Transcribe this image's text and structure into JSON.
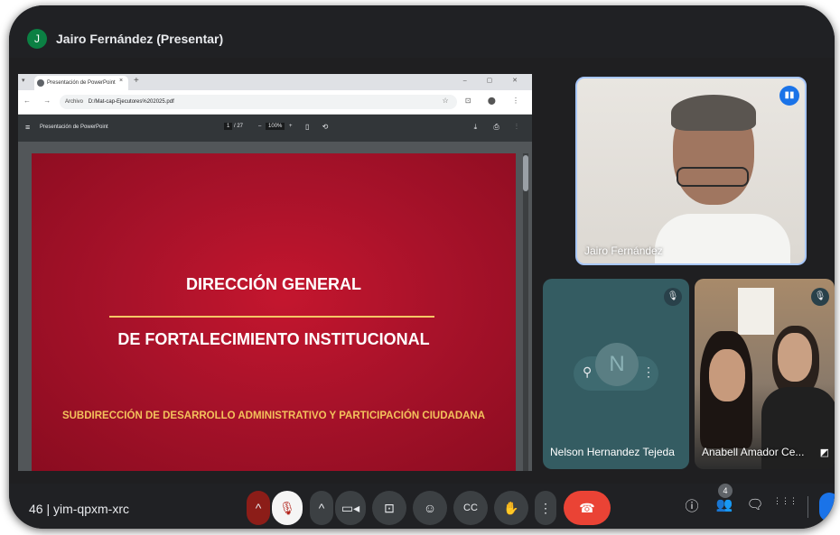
{
  "presenter": {
    "avatar_initial": "J",
    "title": "Jairo Fernández (Presentar)"
  },
  "browser": {
    "tab_title": "Presentación de PowerPoint",
    "tab_close": "×",
    "new_tab": "+",
    "nav_glyphs": "← → C",
    "address_chip": "Archivo",
    "address": "D:/Mat-cap-Ejecutores%202025.pdf",
    "window_controls": "– ▢ ✕",
    "addr_icons": "☆ ⊡ ⬤ ⋮"
  },
  "pdf_viewer": {
    "menu_glyph": "≡",
    "title": "Presentación de PowerPoint",
    "page_current": "1",
    "page_total": "/ 27",
    "zoom_minus": "–",
    "zoom_value": "100%",
    "zoom_plus": "+",
    "tool_glyphs": "▯ ⟲",
    "right_glyphs": "⤓ ⎙ ⋮"
  },
  "slide": {
    "heading_1": "DIRECCIÓN GENERAL",
    "heading_2": "DE FORTALECIMIENTO INSTITUCIONAL",
    "subheading": "SUBDIRECCIÓN DE DESARROLLO ADMINISTRATIVO Y PARTICIPACIÓN CIUDADANA"
  },
  "participants": [
    {
      "name": "Jairo Fernández",
      "state": "speaking"
    },
    {
      "name": "Nelson Hernandez Tejeda",
      "avatar_initial": "N",
      "state": "muted"
    },
    {
      "name": "Anabell Amador Ce...",
      "state": "muted"
    }
  ],
  "meeting": {
    "code": "46 | yim-qpxm-xrc",
    "people_count": "4"
  },
  "controls": {
    "chevron_up": "^",
    "mic": "🎙",
    "camera": "▭◂",
    "present": "⊡",
    "emoji": "☺",
    "captions": "CC",
    "hand": "✋",
    "more": "⋮",
    "hangup": "☎",
    "info": "ⓘ",
    "people": "👥",
    "chat": "🗨",
    "activities": "⋮⋮⋮"
  },
  "colors": {
    "accent": "#1a73e8",
    "slide_red": "#a8122a",
    "slide_gold": "#f3c25c",
    "hangup": "#ea4335"
  }
}
